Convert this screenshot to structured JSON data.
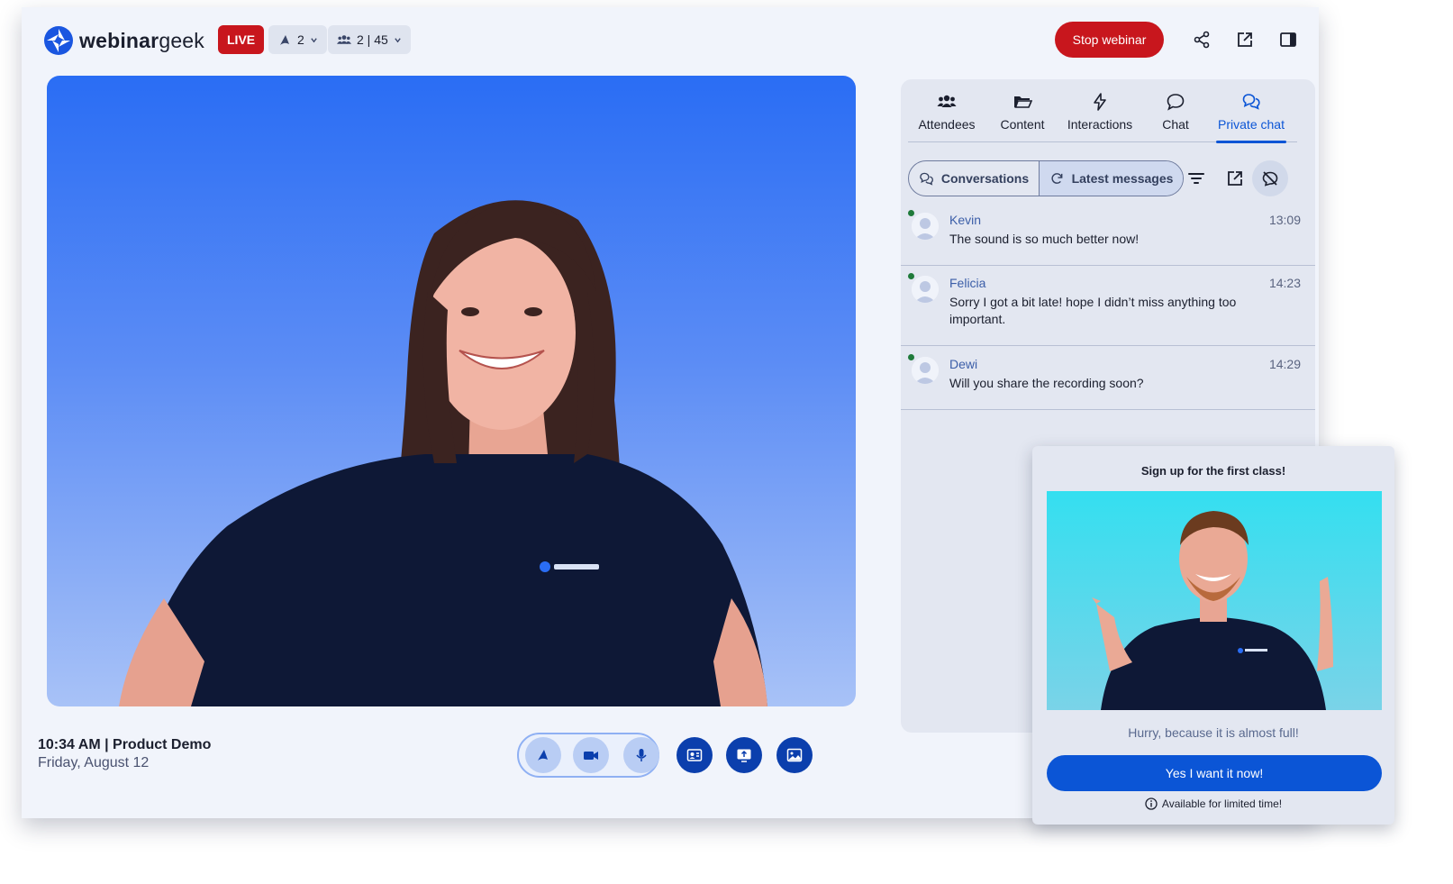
{
  "header": {
    "logo_strong": "webinar",
    "logo_light": "geek",
    "live_label": "LIVE",
    "presenters_count": "2",
    "attendees_count": "2 | 45",
    "stop_label": "Stop webinar",
    "icons": [
      "share-icon",
      "external-link-icon",
      "panel-toggle-icon"
    ]
  },
  "footer": {
    "time_title": "10:34 AM | Product Demo",
    "date": "Friday, August 12",
    "controls": [
      "presenter-icon",
      "camera-icon",
      "microphone-icon",
      "contact-card-icon",
      "screen-share-icon",
      "image-icon"
    ]
  },
  "side": {
    "tabs": [
      {
        "label": "Attendees",
        "icon": "attendees-icon"
      },
      {
        "label": "Content",
        "icon": "folder-icon"
      },
      {
        "label": "Interactions",
        "icon": "lightning-icon"
      },
      {
        "label": "Chat",
        "icon": "chat-bubble-icon"
      },
      {
        "label": "Private chat",
        "icon": "private-chat-icon"
      }
    ],
    "active_tab": "Private chat",
    "segment": {
      "conversations": "Conversations",
      "latest": "Latest messages"
    },
    "messages": [
      {
        "name": "Kevin",
        "time": "13:09",
        "text": "The sound is so much better now!"
      },
      {
        "name": "Felicia",
        "time": "14:23",
        "text": "Sorry I got a bit late! hope I didn’t miss anything too important."
      },
      {
        "name": "Dewi",
        "time": "14:29",
        "text": "Will you share the recording soon?"
      }
    ]
  },
  "popup": {
    "title": "Sign up for the first class!",
    "subtitle": "Hurry, because it is almost full!",
    "cta": "Yes I want it now!",
    "note": "Available for limited time!"
  },
  "colors": {
    "live": "#c8161d",
    "stop": "#c8161d",
    "accent": "#0b55d6",
    "control_dark": "#0b3fad",
    "online": "#1f7a3a"
  }
}
